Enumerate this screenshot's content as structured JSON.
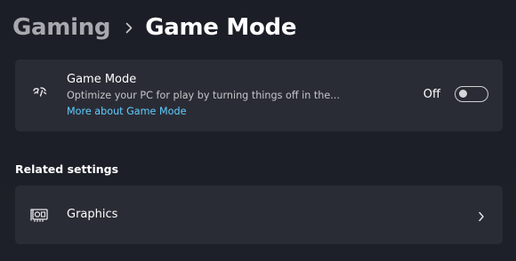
{
  "breadcrumb": {
    "parent": "Gaming",
    "current": "Game Mode"
  },
  "game_mode_card": {
    "icon": "game-mode-icon",
    "title": "Game Mode",
    "description": "Optimize your PC for play by turning things off in the...",
    "link": "More about Game Mode",
    "toggle_label": "Off",
    "toggle_on": false
  },
  "related_settings": {
    "heading": "Related settings",
    "items": [
      {
        "icon": "graphics-card-icon",
        "label": "Graphics",
        "chevron": "chevron-right-icon"
      }
    ]
  },
  "colors": {
    "background": "#1d1f28",
    "card": "#2a2c35",
    "link": "#60cdff",
    "muted_text": "#a7a9ae"
  }
}
